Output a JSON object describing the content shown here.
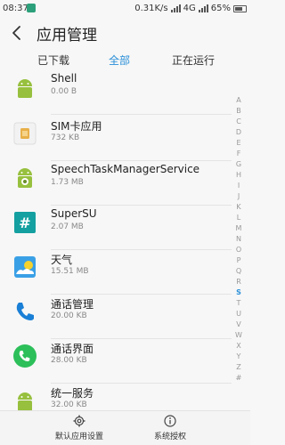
{
  "status_bar": {
    "time": "08:37",
    "speed": "0.31K/s",
    "network": "4G",
    "battery": "65%"
  },
  "header": {
    "title": "应用管理"
  },
  "tabs": [
    {
      "label": "已下载",
      "active": false
    },
    {
      "label": "全部",
      "active": true
    },
    {
      "label": "正在运行",
      "active": false
    }
  ],
  "apps": [
    {
      "name": "Shell",
      "size": "0.00 B",
      "icon": "android-icon"
    },
    {
      "name": "SIM卡应用",
      "size": "732 KB",
      "icon": "sim-card-icon"
    },
    {
      "name": "SpeechTaskManagerService",
      "size": "1.73 MB",
      "icon": "android-gear-icon"
    },
    {
      "name": "SuperSU",
      "size": "2.07 MB",
      "icon": "supersu-icon"
    },
    {
      "name": "天气",
      "size": "15.51 MB",
      "icon": "weather-icon"
    },
    {
      "name": "通话管理",
      "size": "20.00 KB",
      "icon": "phone-icon"
    },
    {
      "name": "通话界面",
      "size": "28.00 KB",
      "icon": "phone-green-icon"
    },
    {
      "name": "统一服务",
      "size": "32.00 KB",
      "icon": "android-icon"
    }
  ],
  "index": {
    "letters": [
      "A",
      "B",
      "C",
      "D",
      "E",
      "F",
      "G",
      "H",
      "I",
      "J",
      "K",
      "L",
      "M",
      "N",
      "O",
      "P",
      "Q",
      "R",
      "S",
      "T",
      "U",
      "V",
      "W",
      "X",
      "Y",
      "Z",
      "#"
    ],
    "active": "S"
  },
  "bottom_bar": {
    "default_apps_label": "默认应用设置",
    "permissions_label": "系统授权"
  },
  "colors": {
    "accent": "#2a8fd8",
    "android_green": "#97c03e",
    "supersu_teal": "#14a0a0"
  }
}
